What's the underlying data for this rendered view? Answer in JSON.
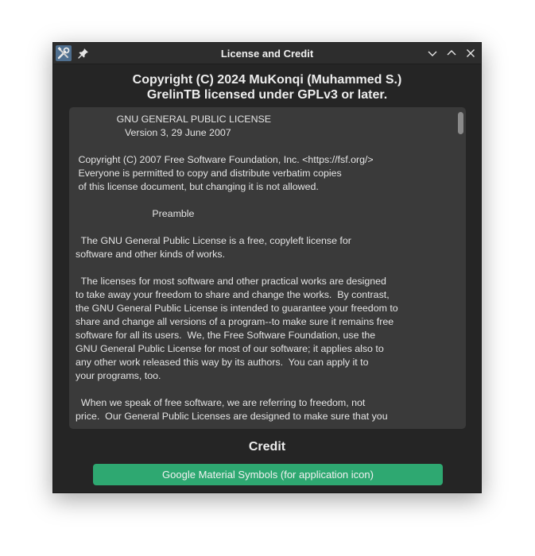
{
  "window": {
    "title": "License and Credit"
  },
  "header": {
    "copyright_line1": "Copyright (C) 2024 MuKonqi (Muhammed S.)",
    "copyright_line2": "GrelinTB licensed under GPLv3 or later."
  },
  "license": {
    "text": "               GNU GENERAL PUBLIC LICENSE\n                  Version 3, 29 June 2007\n\n Copyright (C) 2007 Free Software Foundation, Inc. <https://fsf.org/>\n Everyone is permitted to copy and distribute verbatim copies\n of this license document, but changing it is not allowed.\n\n                            Preamble\n\n  The GNU General Public License is a free, copyleft license for\nsoftware and other kinds of works.\n\n  The licenses for most software and other practical works are designed\nto take away your freedom to share and change the works.  By contrast,\nthe GNU General Public License is intended to guarantee your freedom to\nshare and change all versions of a program--to make sure it remains free\nsoftware for all its users.  We, the Free Software Foundation, use the\nGNU General Public License for most of our software; it applies also to\nany other work released this way by its authors.  You can apply it to\nyour programs, too.\n\n  When we speak of free software, we are referring to freedom, not\nprice.  Our General Public Licenses are designed to make sure that you"
  },
  "credit": {
    "heading": "Credit",
    "button_label": "Google Material Symbols (for application icon)"
  },
  "icons": {
    "app": "tools-icon",
    "pin": "pin-icon",
    "minimize": "chevron-down-icon",
    "maximize": "chevron-up-icon",
    "close": "close-icon"
  },
  "colors": {
    "window_bg": "#252525",
    "textbox_bg": "#3a3a3a",
    "accent": "#2ea871"
  }
}
